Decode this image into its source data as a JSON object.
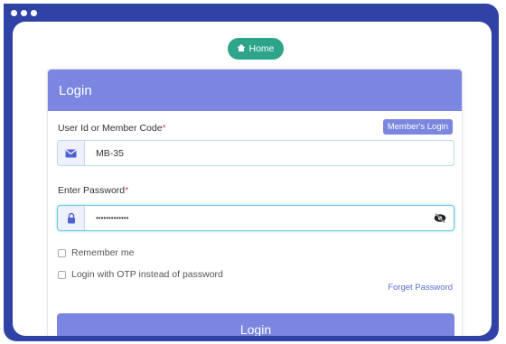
{
  "window": {
    "controls": [
      "dot",
      "dot",
      "dot"
    ]
  },
  "nav": {
    "home_label": "Home",
    "home_icon": "home-icon"
  },
  "login_card": {
    "title": "Login",
    "user_field": {
      "label": "User Id or Member Code",
      "required_mark": "*",
      "value": "MB-35",
      "icon": "envelope-icon"
    },
    "members_login_label": "Member's Login",
    "password_field": {
      "label": "Enter Password",
      "required_mark": "*",
      "value": "•••••••••••••",
      "icon": "lock-icon",
      "toggle_icon": "eye-slash-icon"
    },
    "remember_label": "Remember me",
    "otp_label": "Login with OTP instead of password",
    "forget_label": "Forget Password",
    "submit_label": "Login"
  },
  "colors": {
    "frame": "#2f43a6",
    "header": "#7b86e0",
    "home_button": "#2ea58a"
  }
}
